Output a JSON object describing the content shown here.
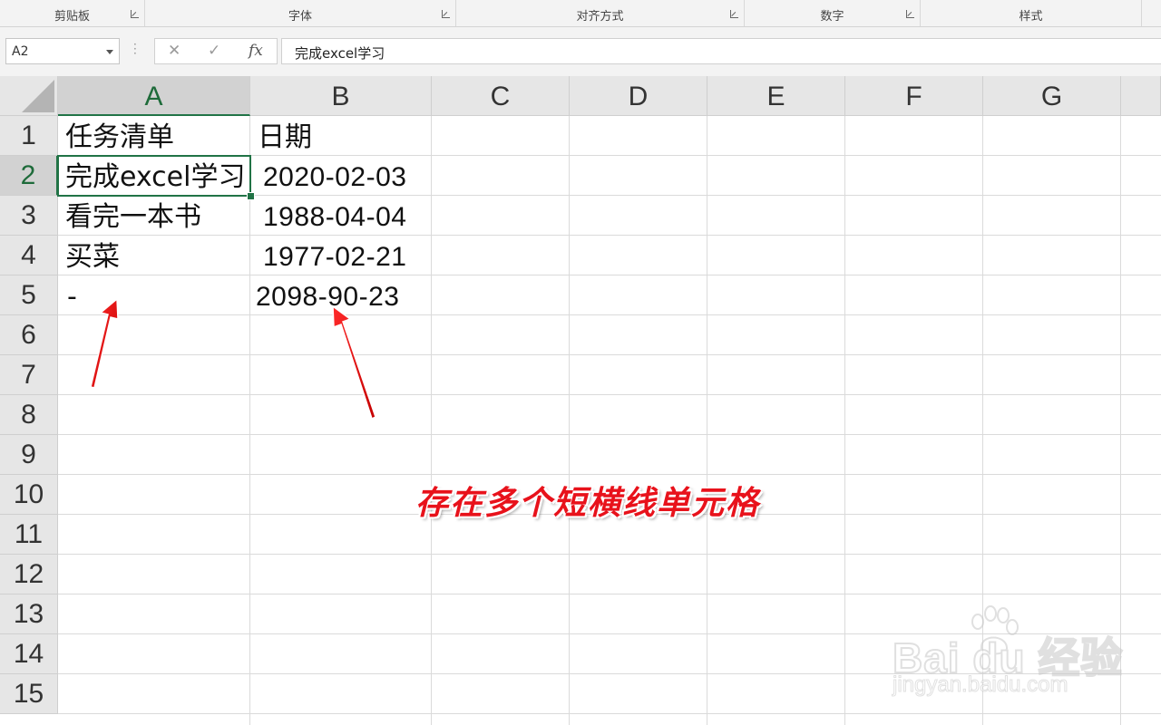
{
  "ribbon": {
    "groups": [
      {
        "label": "剪贴板"
      },
      {
        "label": "字体"
      },
      {
        "label": "对齐方式"
      },
      {
        "label": "数字"
      },
      {
        "label": "样式"
      }
    ]
  },
  "formula_bar": {
    "name_box": "A2",
    "cancel_icon": "✕",
    "enter_icon": "✓",
    "fx_label": "fx",
    "content": "完成excel学习"
  },
  "sheet": {
    "columns": [
      "A",
      "B",
      "C",
      "D",
      "E",
      "F",
      "G"
    ],
    "rows": [
      "1",
      "2",
      "3",
      "4",
      "5",
      "6",
      "7",
      "8",
      "9",
      "10",
      "11",
      "12",
      "13",
      "14",
      "15"
    ],
    "selected_cell": "A2",
    "cells": {
      "A1": "任务清单",
      "B1": "日期",
      "A2": "完成excel学习",
      "B2": "2020-02-03",
      "A3": "看完一本书",
      "B3": "1988-04-04",
      "A4": "买菜",
      "B4": "1977-02-21",
      "A5": "-",
      "B5": "2098-90-23"
    }
  },
  "annotation": {
    "callout_text": "存在多个短横线单元格",
    "arrow_color": "#e8121b"
  },
  "watermark": {
    "logo_text": "Bai du 经验",
    "url_text": "jingyan.baidu.com"
  },
  "colors": {
    "accent": "#217346",
    "header_bg": "#e6e6e6",
    "gridline": "#dadada"
  }
}
